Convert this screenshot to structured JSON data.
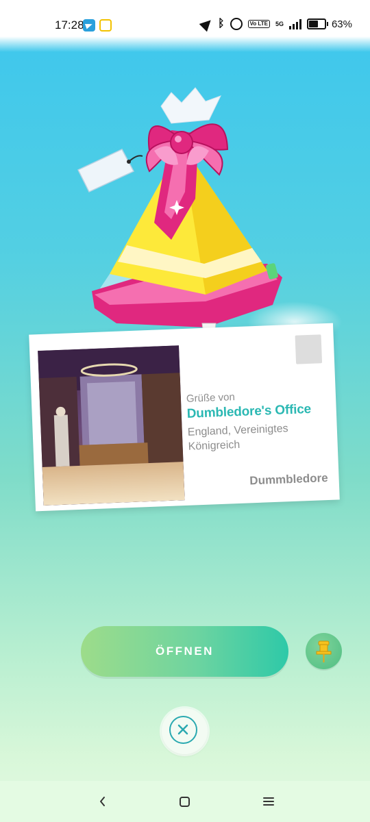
{
  "status_bar": {
    "time": "17:28",
    "network": "5G",
    "volte": "Vo LTE",
    "battery": "63%",
    "battery_level": 0.63
  },
  "postcard": {
    "greeting_label": "Grüße von",
    "location_name": "Dumbledore's Office",
    "location_region": "England, Vereinigtes Königreich",
    "sender": "Dummbledore"
  },
  "actions": {
    "open_label": "ÖFFNEN"
  },
  "colors": {
    "accent_teal": "#2bb8b3",
    "gift_pink": "#e0287f",
    "gift_yellow": "#fde93a"
  },
  "icons": {
    "pin": "pin-icon",
    "close": "close-icon",
    "back": "back-icon",
    "home": "home-icon",
    "recents": "recents-icon"
  }
}
